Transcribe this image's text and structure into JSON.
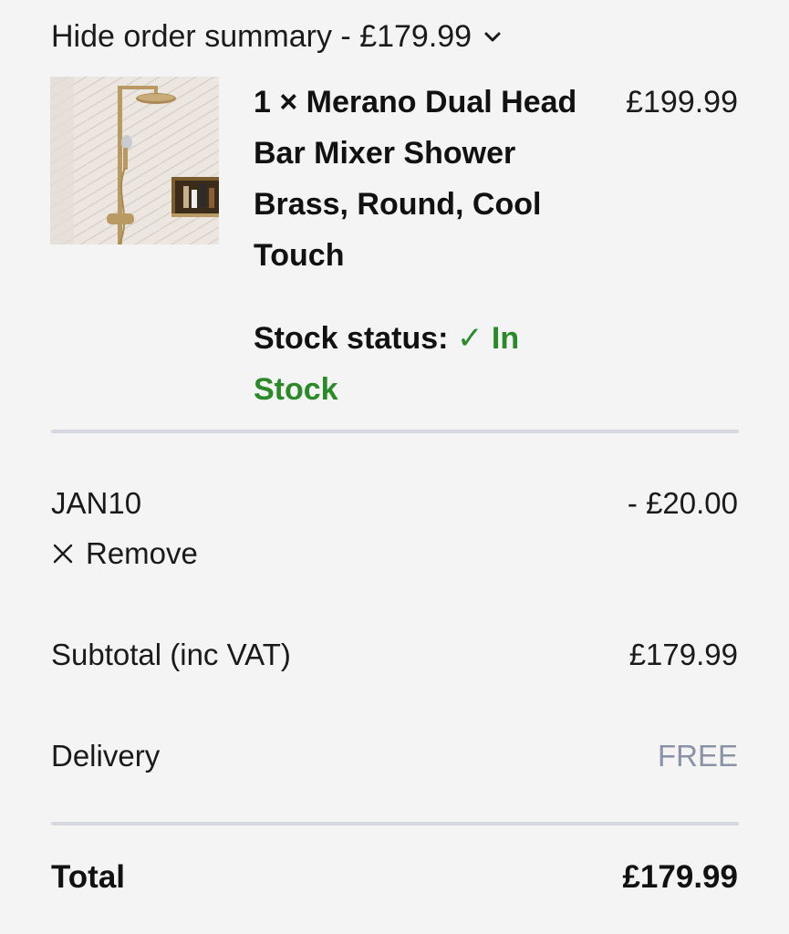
{
  "summary": {
    "toggle_label": "Hide order summary - £179.99",
    "toggle_icon": "chevron-down-icon"
  },
  "item": {
    "quantity_name": "1 × Merano Dual Head Bar Mixer Shower Brass, Round, Cool Touch",
    "price": "£199.99",
    "stock_label": "Stock status:",
    "stock_value": "✓ In Stock",
    "stock_color": "#2b8a28"
  },
  "discount": {
    "code": "JAN10",
    "amount": "- £20.00",
    "remove_label": "Remove",
    "remove_icon": "close-icon"
  },
  "subtotal": {
    "label": "Subtotal (inc VAT)",
    "value": "£179.99"
  },
  "delivery": {
    "label": "Delivery",
    "value": "FREE",
    "value_color": "#8a93a5"
  },
  "total": {
    "label": "Total",
    "value": "£179.99"
  }
}
